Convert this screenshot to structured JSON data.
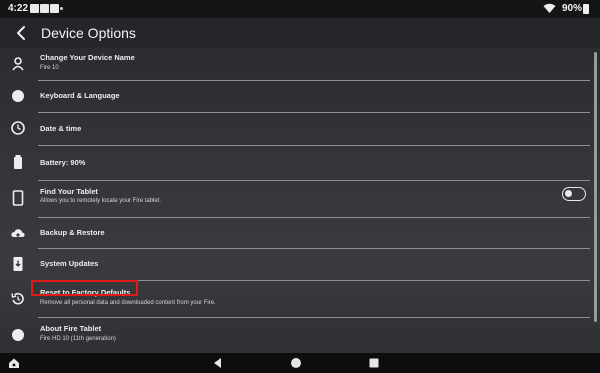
{
  "status_bar": {
    "time": "4:22",
    "notification_icons": [
      "app-icon",
      "app-icon",
      "app-icon"
    ],
    "battery_percent": "90%"
  },
  "header": {
    "title": "Device Options"
  },
  "settings": [
    {
      "label": "Change Your Device Name",
      "sub": "Fire 10",
      "icon": "person-icon"
    },
    {
      "label": "Keyboard & Language",
      "sub": "",
      "icon": "globe-icon"
    },
    {
      "label": "Date & time",
      "sub": "",
      "icon": "clock-icon"
    },
    {
      "label": "Battery: 90%",
      "sub": "",
      "icon": "battery-icon"
    },
    {
      "label": "Find Your Tablet",
      "sub": "Allows you to remotely locate your Fire tablet.",
      "icon": "tablet-icon",
      "toggle": "off"
    },
    {
      "label": "Backup & Restore",
      "sub": "",
      "icon": "cloud-icon"
    },
    {
      "label": "System Updates",
      "sub": "",
      "icon": "system-update-icon"
    },
    {
      "label": "Reset to Factory Defaults",
      "sub": "Remove all personal data and downloaded content from your Fire.",
      "icon": "reset-icon",
      "highlighted": true
    },
    {
      "label": "About Fire Tablet",
      "sub": "Fire HD 10 (11th generation)",
      "icon": "info-icon"
    }
  ],
  "colors": {
    "highlight": "#e01919",
    "background": "#2f3033",
    "text": "#ededed"
  },
  "navigation": [
    "home-icon",
    "back-icon",
    "home-circle-icon",
    "recents-icon"
  ]
}
